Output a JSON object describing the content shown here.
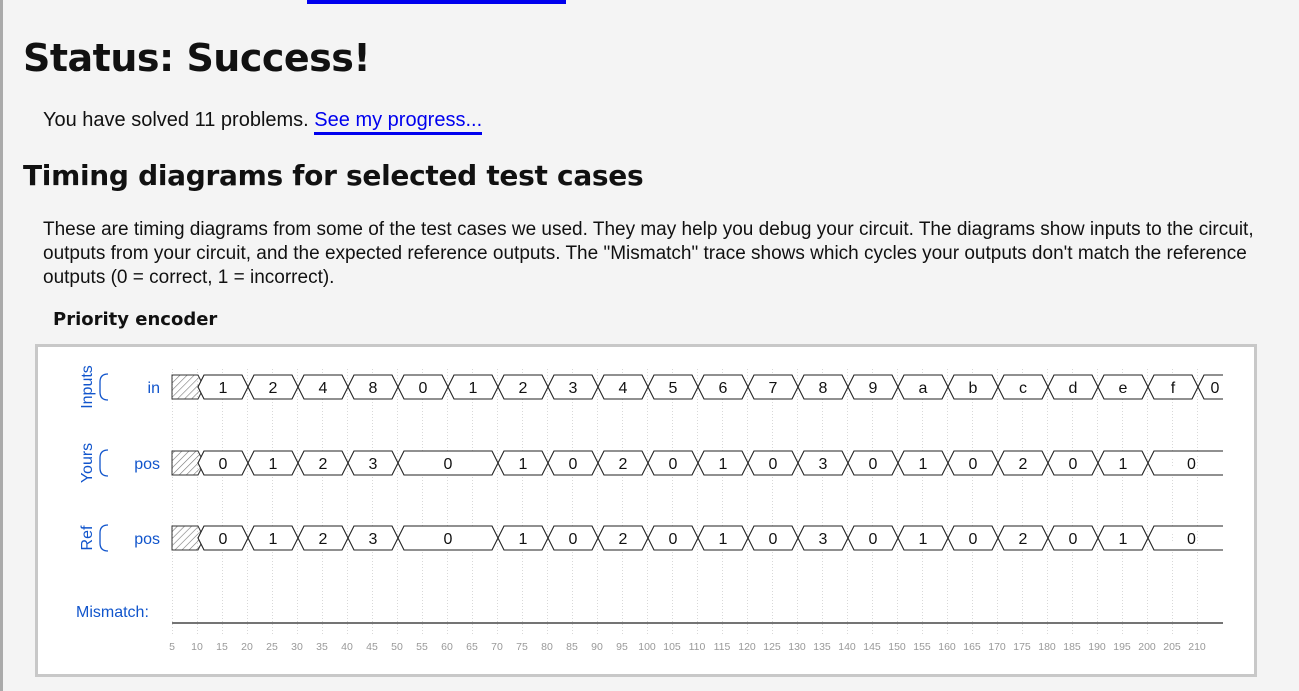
{
  "status_title": "Status: Success!",
  "progress": {
    "prefix": "You have solved 11 problems. ",
    "link_label": "See my progress..."
  },
  "section_heading": "Timing diagrams for selected test cases",
  "description": "These are timing diagrams from some of the test cases we used. They may help you debug your circuit. The diagrams show inputs to the circuit, outputs from your circuit, and the expected reference outputs. The \"Mismatch\" trace shows which cycles your outputs don't match the reference outputs (0 = correct, 1 = incorrect).",
  "diagram": {
    "title": "Priority encoder",
    "groups": [
      {
        "label": "Inputs",
        "signal": "in"
      },
      {
        "label": "Yours",
        "signal": "pos"
      },
      {
        "label": "Ref",
        "signal": "pos"
      }
    ],
    "mismatch_label": "Mismatch:",
    "traces": [
      {
        "name": "in",
        "values": [
          "1",
          "2",
          "4",
          "8",
          "0",
          "1",
          "2",
          "3",
          "4",
          "5",
          "6",
          "7",
          "8",
          "9",
          "a",
          "b",
          "c",
          "d",
          "e",
          "f",
          "0"
        ]
      },
      {
        "name": "yours_pos",
        "values": [
          "0",
          "1",
          "2",
          "3",
          "0",
          "0",
          "1",
          "0",
          "2",
          "0",
          "1",
          "0",
          "3",
          "0",
          "1",
          "0",
          "2",
          "0",
          "1",
          "0",
          "0"
        ]
      },
      {
        "name": "ref_pos",
        "values": [
          "0",
          "1",
          "2",
          "3",
          "0",
          "0",
          "1",
          "0",
          "2",
          "0",
          "1",
          "0",
          "3",
          "0",
          "1",
          "0",
          "2",
          "0",
          "1",
          "0",
          "0"
        ]
      }
    ],
    "mismatch": [
      0,
      0,
      0,
      0,
      0,
      0,
      0,
      0,
      0,
      0,
      0,
      0,
      0,
      0,
      0,
      0,
      0,
      0,
      0,
      0,
      0
    ],
    "time_ticks": [
      "5",
      "10",
      "15",
      "20",
      "25",
      "30",
      "35",
      "40",
      "45",
      "50",
      "55",
      "60",
      "65",
      "70",
      "75",
      "80",
      "85",
      "90",
      "95",
      "100",
      "105",
      "110",
      "115",
      "120",
      "125",
      "130",
      "135",
      "140",
      "145",
      "150",
      "155",
      "160",
      "165",
      "170",
      "175",
      "180",
      "185",
      "190",
      "195",
      "200",
      "205",
      "210"
    ],
    "colors": {
      "label_blue": "#1155cc",
      "tick_gray": "#999999",
      "grid_gray": "#d8d8d8",
      "hatch": "#777777"
    }
  }
}
